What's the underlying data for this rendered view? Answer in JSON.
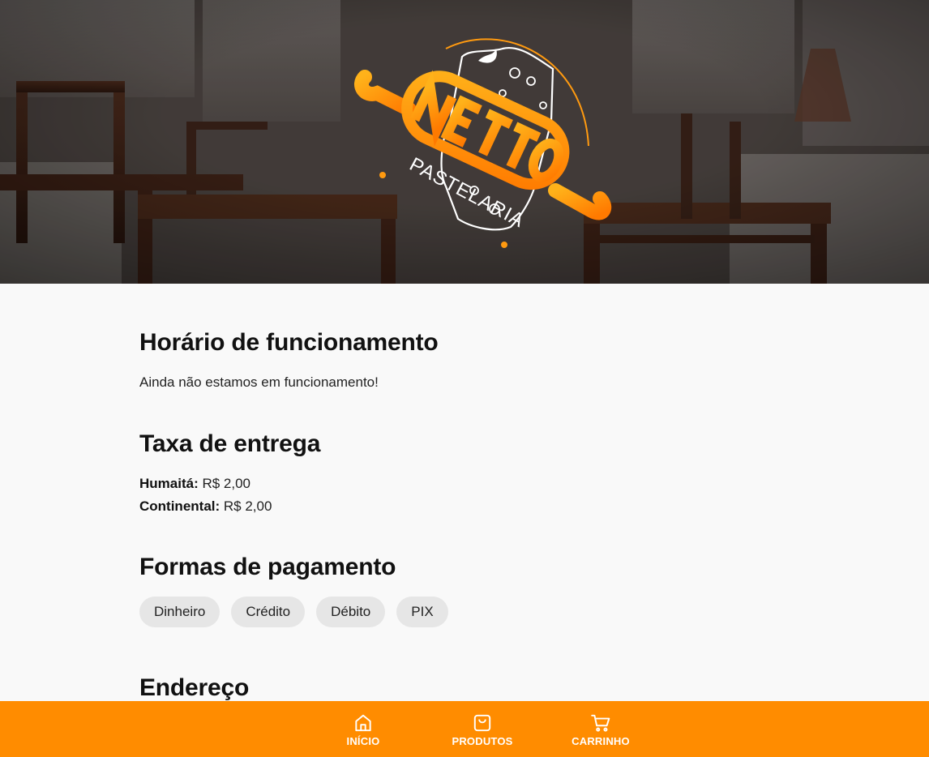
{
  "brand": {
    "name": "NETTO",
    "subtitle": "PASTELARIA",
    "accent_color": "#ff8c00"
  },
  "hours": {
    "title": "Horário de funcionamento",
    "text": "Ainda não estamos em funcionamento!"
  },
  "delivery_fee": {
    "title": "Taxa de entrega",
    "rows": [
      {
        "place": "Humaitá:",
        "price": "R$ 2,00"
      },
      {
        "place": "Continental:",
        "price": "R$ 2,00"
      }
    ]
  },
  "payment": {
    "title": "Formas de pagamento",
    "methods": [
      "Dinheiro",
      "Crédito",
      "Débito",
      "PIX"
    ]
  },
  "address": {
    "title": "Endereço"
  },
  "nav": {
    "items": [
      {
        "label": "INÍCIO",
        "icon": "home-icon"
      },
      {
        "label": "PRODUTOS",
        "icon": "shopping-bag-icon"
      },
      {
        "label": "CARRINHO",
        "icon": "cart-icon"
      }
    ]
  }
}
